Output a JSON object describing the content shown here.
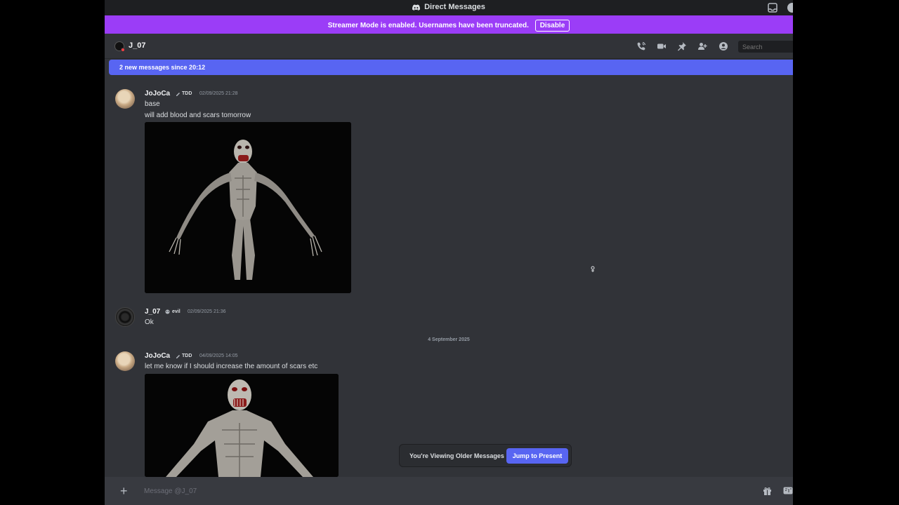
{
  "titlebar": {
    "title": "Direct Messages"
  },
  "streamer_banner": {
    "text": "Streamer Mode is enabled. Usernames have been truncated.",
    "button": "Disable"
  },
  "header": {
    "name": "J_07",
    "search_placeholder": "Search",
    "icons": [
      "phone-call-icon",
      "video-camera-icon",
      "pin-icon",
      "add-friend-icon",
      "profile-icon"
    ]
  },
  "new_messages_bar": {
    "text": "2 new messages since 20:12"
  },
  "messages": [
    {
      "author": "JoJoCa",
      "tag": "TDD",
      "timestamp": "02/09/2025 21:28",
      "lines": [
        "base",
        "will add blood and scars tomorrow"
      ],
      "attachment": "3d-creature-model-render"
    },
    {
      "author": "J_07",
      "tag": "evil",
      "timestamp": "02/09/2025 21:36",
      "lines": [
        "Ok"
      ]
    },
    {
      "author": "JoJoCa",
      "tag": "TDD",
      "timestamp": "04/09/2025 14:05",
      "lines": [
        "let me know if I should increase the amount of scars etc"
      ],
      "attachment": "3d-creature-model-render-closeup"
    }
  ],
  "date_divider": "4 September 2025",
  "older_messages": {
    "label": "You're Viewing Older Messages",
    "button": "Jump to Present"
  },
  "composer": {
    "placeholder": "Message @J_07"
  },
  "colors": {
    "background": "#313338",
    "streamer_banner": "#9b3df7",
    "accent": "#5865f2",
    "titlebar": "#1e1f22"
  }
}
